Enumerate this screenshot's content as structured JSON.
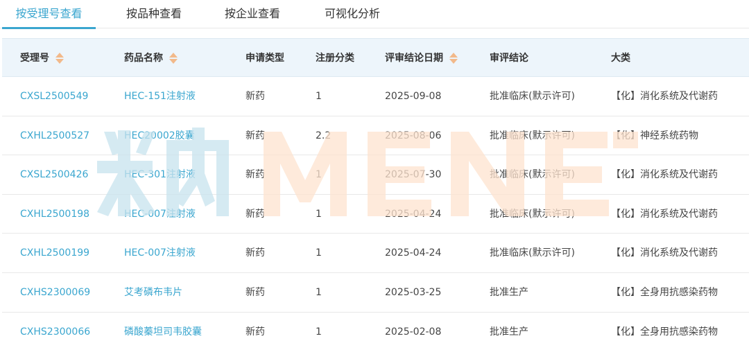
{
  "tabs": [
    {
      "label": "按受理号查看",
      "active": true
    },
    {
      "label": "按品种查看",
      "active": false
    },
    {
      "label": "按企业查看",
      "active": false
    },
    {
      "label": "可视化分析",
      "active": false
    }
  ],
  "table": {
    "headers": [
      "受理号",
      "药品名称",
      "申请类型",
      "注册分类",
      "评审结论日期",
      "审评结论",
      "大类"
    ],
    "sortable": [
      true,
      true,
      false,
      false,
      true,
      false,
      false
    ],
    "rows": [
      {
        "acceptance_no": "CXSL2500549",
        "drug_name": "HEC-151注射液",
        "apply_type": "新药",
        "reg_class": "1",
        "date": "2025-09-08",
        "conclusion": "批准临床(默示许可)",
        "category": "【化】消化系统及代谢药"
      },
      {
        "acceptance_no": "CXHL2500527",
        "drug_name": "HEC20002胶囊",
        "apply_type": "新药",
        "reg_class": "2.2",
        "date": "2025-08-06",
        "conclusion": "批准临床(默示许可)",
        "category": "【化】神经系统药物"
      },
      {
        "acceptance_no": "CXSL2500426",
        "drug_name": "HEC-301注射液",
        "apply_type": "新药",
        "reg_class": "1",
        "date": "2025-07-30",
        "conclusion": "批准临床(默示许可)",
        "category": "【化】消化系统及代谢药"
      },
      {
        "acceptance_no": "CXHL2500198",
        "drug_name": "HEC-007注射液",
        "apply_type": "新药",
        "reg_class": "1",
        "date": "2025-04-24",
        "conclusion": "批准临床(默示许可)",
        "category": "【化】消化系统及代谢药"
      },
      {
        "acceptance_no": "CXHL2500199",
        "drug_name": "HEC-007注射液",
        "apply_type": "新药",
        "reg_class": "1",
        "date": "2025-04-24",
        "conclusion": "批准临床(默示许可)",
        "category": "【化】消化系统及代谢药"
      },
      {
        "acceptance_no": "CXHS2300069",
        "drug_name": "艾考磷布韦片",
        "apply_type": "新药",
        "reg_class": "1",
        "date": "2025-03-25",
        "conclusion": "批准生产",
        "category": "【化】全身用抗感染药物"
      },
      {
        "acceptance_no": "CXHS2300066",
        "drug_name": "磷酸蓁坦司韦胶囊",
        "apply_type": "新药",
        "reg_class": "1",
        "date": "2025-02-08",
        "conclusion": "批准生产",
        "category": "【化】全身用抗感染药物"
      }
    ]
  },
  "watermark": {
    "text": "米内MENET",
    "colors": {
      "left": "#c8e3ee",
      "right": "#fde3cf"
    }
  },
  "colors": {
    "accent": "#3aa6cf",
    "header_bg": "#edf5fb",
    "sort_arrow": "#f2b98a"
  }
}
